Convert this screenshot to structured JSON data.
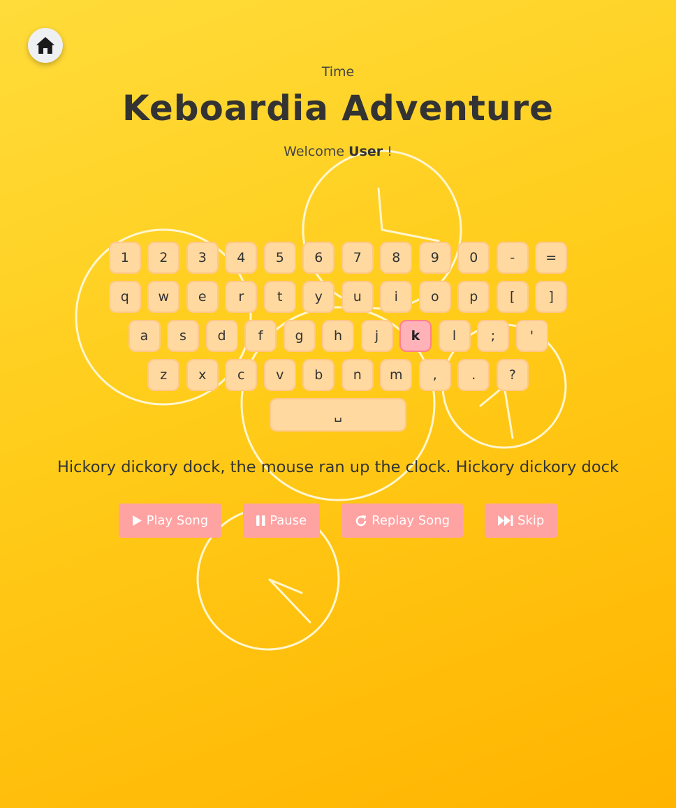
{
  "nav": {
    "home_icon": "home-icon"
  },
  "header": {
    "time_label": "Time",
    "title": "Keboardia Adventure",
    "welcome_prefix": "Welcome",
    "username": "User",
    "welcome_suffix": "!"
  },
  "keyboard": {
    "rows": [
      [
        "1",
        "2",
        "3",
        "4",
        "5",
        "6",
        "7",
        "8",
        "9",
        "0",
        "-",
        "="
      ],
      [
        "q",
        "w",
        "e",
        "r",
        "t",
        "y",
        "u",
        "i",
        "o",
        "p",
        "[",
        "]"
      ],
      [
        "a",
        "s",
        "d",
        "f",
        "g",
        "h",
        "j",
        "k",
        "l",
        ";",
        "'"
      ],
      [
        "z",
        "x",
        "c",
        "v",
        "b",
        "n",
        "m",
        ",",
        ".",
        "?"
      ]
    ],
    "space_label": "␣",
    "active_key": "k"
  },
  "lyric": "Hickory dickory dock, the mouse ran up the clock. Hickory dickory dock",
  "controls": {
    "play_label": "Play Song",
    "pause_label": "Pause",
    "replay_label": "Replay Song",
    "skip_label": "Skip"
  },
  "colors": {
    "key_bg": "#ffd9a0",
    "key_active_bg": "#ffb3b8",
    "button_bg": "#ffa2a2"
  }
}
